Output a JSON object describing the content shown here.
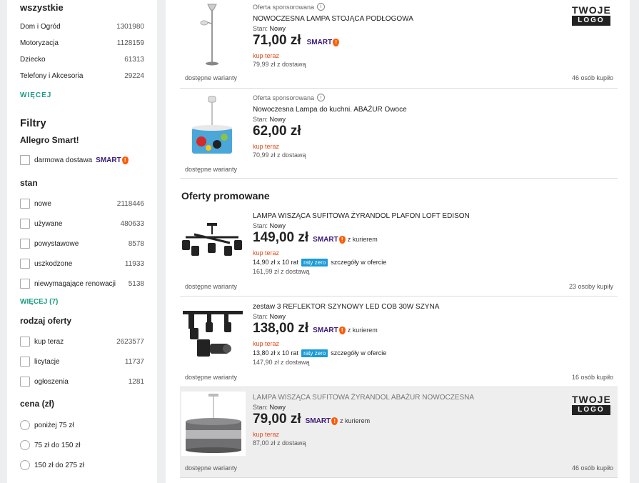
{
  "sidebar": {
    "category_heading": "wszystkie",
    "categories": [
      {
        "label": "Dom i Ogród",
        "count": "1301980"
      },
      {
        "label": "Motoryzacja",
        "count": "1128159"
      },
      {
        "label": "Dziecko",
        "count": "61313"
      },
      {
        "label": "Telefony i Akcesoria",
        "count": "29224"
      }
    ],
    "more_categories": "WIĘCEJ",
    "filters_title": "Filtry",
    "smart_group": "Allegro Smart!",
    "free_delivery": "darmowa dostawa",
    "smart_label": "SMART",
    "state_group": "stan",
    "states": [
      {
        "label": "nowe",
        "count": "2118446"
      },
      {
        "label": "używane",
        "count": "480633"
      },
      {
        "label": "powystawowe",
        "count": "8578"
      },
      {
        "label": "uszkodzone",
        "count": "11933"
      },
      {
        "label": "niewymagające renowacji",
        "count": "5138"
      }
    ],
    "more_states": "WIĘCEJ (7)",
    "offer_type_group": "rodzaj oferty",
    "offer_types": [
      {
        "label": "kup teraz",
        "count": "2623577"
      },
      {
        "label": "licytacje",
        "count": "11737"
      },
      {
        "label": "ogłoszenia",
        "count": "1281"
      }
    ],
    "price_group": "cena (zł)",
    "price_ranges": [
      "poniżej 75 zł",
      "75 zł do 150 zł",
      "150 zł do 275 zł"
    ]
  },
  "main": {
    "promoted_title": "Oferty promowane",
    "offers": [
      {
        "sponsored": "Oferta sponsorowana",
        "title": "NOWOCZESNA LAMPA STOJĄCA PODŁOGOWA",
        "condition_label": "Stan:",
        "condition": "Nowy",
        "price_main": "71,00 zł",
        "buy_now": "kup teraz",
        "shipping": "79,99 zł z dostawą",
        "variants": "dostępne warianty",
        "bought": "46 osób kupiło",
        "logo_top": "TWOJE",
        "logo_bottom": "LOGO"
      },
      {
        "sponsored": "Oferta sponsorowana",
        "title": "Nowoczesna Lampa do kuchni. ABAŻUR Owoce",
        "condition_label": "Stan:",
        "condition": "Nowy",
        "price_main": "62,00 zł",
        "buy_now": "kup teraz",
        "shipping": "70,99 zł z dostawą",
        "variants": "dostępne warianty"
      },
      {
        "title": "LAMPA WISZĄCA SUFITOWA ŻYRANDOL PLAFON LOFT EDISON",
        "condition_label": "Stan:",
        "condition": "Nowy",
        "price_main": "149,00 zł",
        "courier": "z kurierem",
        "buy_now": "kup teraz",
        "installment_amount": "14,90 zł",
        "installment_count": "x 10 rat",
        "raty_badge": "raty zero",
        "details": "szczegóły w ofercie",
        "shipping": "161,99 zł z dostawą",
        "variants": "dostępne warianty",
        "bought": "23 osoby kupiły"
      },
      {
        "title": "zestaw 3 REFLEKTOR SZYNOWY LED COB 30W SZYNA",
        "condition_label": "Stan:",
        "condition": "Nowy",
        "price_main": "138,00 zł",
        "courier": "z kurierem",
        "buy_now": "kup teraz",
        "installment_amount": "13,80 zł",
        "installment_count": "x 10 rat",
        "raty_badge": "raty zero",
        "details": "szczegóły w ofercie",
        "shipping": "147,90 zł z dostawą",
        "variants": "dostępne warianty",
        "bought": "16 osób kupiło"
      },
      {
        "title": "LAMPA WISZĄCA SUFITOWA ŻYRANDOL ABAŻUR NOWOCZESNA",
        "condition_label": "Stan:",
        "condition": "Nowy",
        "price_main": "79,00 zł",
        "courier": "z kurierem",
        "buy_now": "kup teraz",
        "shipping": "87,00 zł z dostawą",
        "variants": "dostępne warianty",
        "bought": "46 osób kupiło",
        "logo_top": "TWOJE",
        "logo_bottom": "LOGO"
      }
    ]
  },
  "colors": {
    "accent": "#1a9c82",
    "buy_now": "#e64b1d",
    "smart": "#3a1b78",
    "raty": "#1b9bd8"
  }
}
